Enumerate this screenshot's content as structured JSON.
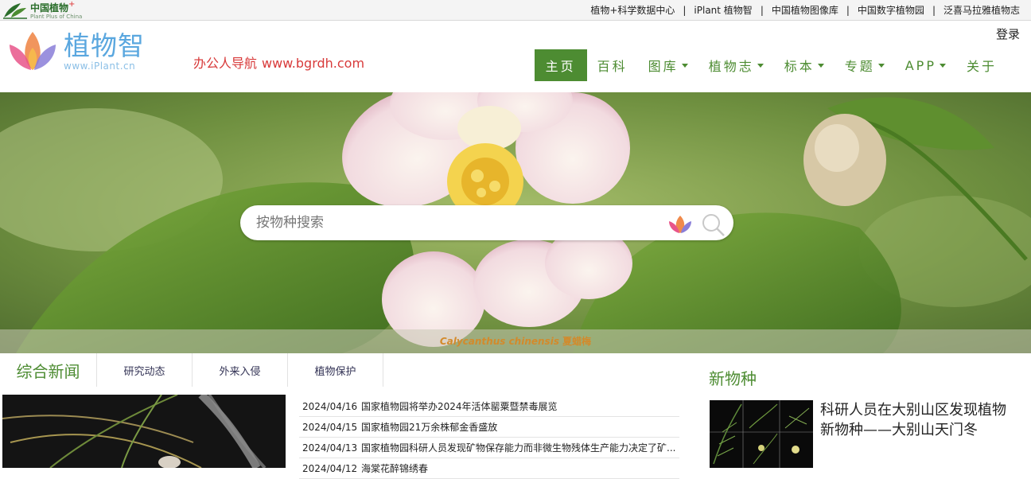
{
  "topbar": {
    "logo_cn": "中国植物",
    "logo_plus": "+",
    "logo_en": "Plant Plus of China",
    "links": [
      "植物+科学数据中心",
      "iPlant 植物智",
      "中国植物图像库",
      "中国数字植物园",
      "泛喜马拉雅植物志"
    ],
    "separator": "|"
  },
  "header": {
    "brand_cn": "植物智",
    "brand_url": "www.iPlant.cn",
    "promo_text": "办公人导航",
    "promo_url": "www.bgrdh.com",
    "login": "登录",
    "nav": [
      {
        "label": "主页",
        "dropdown": false,
        "active": true
      },
      {
        "label": "百科",
        "dropdown": false,
        "active": false
      },
      {
        "label": "图库",
        "dropdown": true,
        "active": false
      },
      {
        "label": "植物志",
        "dropdown": true,
        "active": false
      },
      {
        "label": "标本",
        "dropdown": true,
        "active": false
      },
      {
        "label": "专题",
        "dropdown": true,
        "active": false
      },
      {
        "label": "APP",
        "dropdown": true,
        "active": false
      },
      {
        "label": "关于",
        "dropdown": false,
        "active": false
      }
    ]
  },
  "hero": {
    "search_placeholder": "按物种搜索",
    "caption_scientific": "Calycanthus chinensis",
    "caption_common": "夏蜡梅"
  },
  "news": {
    "tabs": [
      "综合新闻",
      "研究动态",
      "外来入侵",
      "植物保护"
    ],
    "items": [
      {
        "date": "2024/04/16",
        "title": "国家植物园将举办2024年活体罂粟暨禁毒展览"
      },
      {
        "date": "2024/04/15",
        "title": "国家植物园21万余株郁金香盛放"
      },
      {
        "date": "2024/04/13",
        "title": "国家植物园科研人员发现矿物保存能力而非微生物残体生产能力决定了矿..."
      },
      {
        "date": "2024/04/12",
        "title": "海棠花醉锦绣春"
      }
    ]
  },
  "species": {
    "heading": "新物种",
    "title": "科研人员在大别山区发现植物新物种——大别山天门冬"
  },
  "colors": {
    "brand_green": "#4d8c32",
    "brand_blue": "#5aa7df",
    "promo_red": "#d83a3a",
    "caption_orange": "#d38a2b"
  }
}
